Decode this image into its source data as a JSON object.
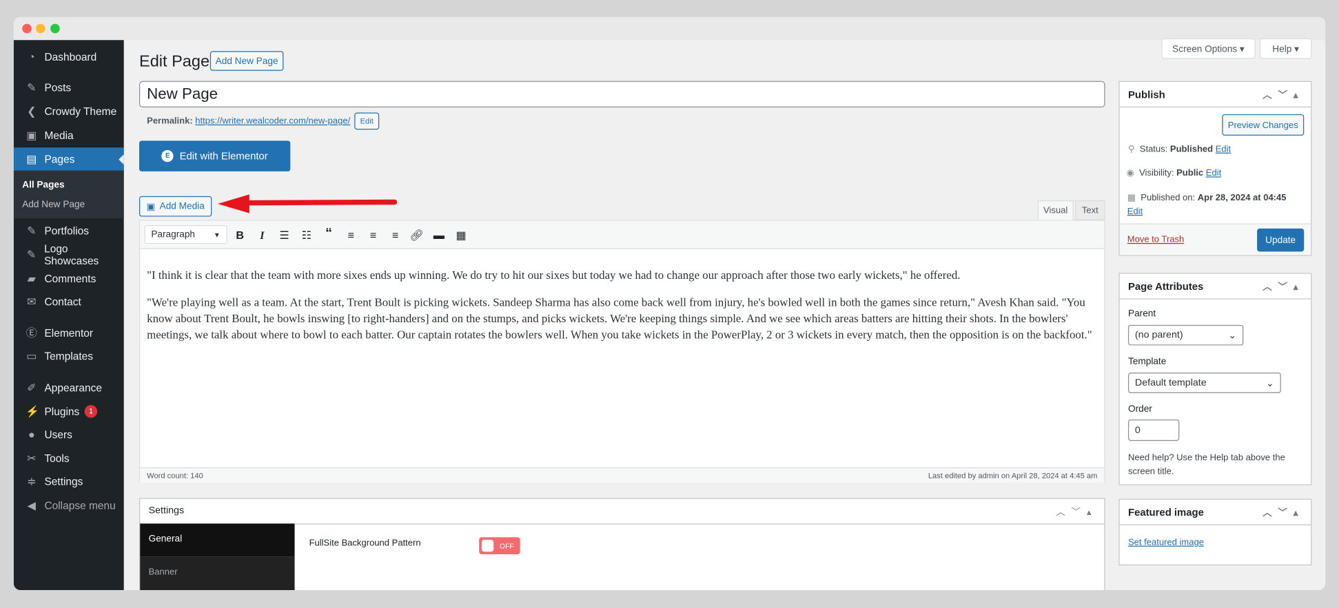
{
  "sidebar": {
    "items": [
      {
        "label": "Dashboard",
        "icon": "dashboard-icon",
        "glyph": "◔"
      },
      {
        "label": "Posts",
        "icon": "pin-icon",
        "glyph": "✎"
      },
      {
        "label": "Crowdy Theme",
        "icon": "crowdy-icon",
        "glyph": "❮"
      },
      {
        "label": "Media",
        "icon": "media-icon",
        "glyph": "▣"
      },
      {
        "label": "Pages",
        "icon": "pages-icon",
        "glyph": "▤"
      },
      {
        "label": "Portfolios",
        "icon": "pin-icon",
        "glyph": "✎"
      },
      {
        "label": "Logo Showcases",
        "icon": "pin-icon",
        "glyph": "✎"
      },
      {
        "label": "Comments",
        "icon": "comment-icon",
        "glyph": "▰"
      },
      {
        "label": "Contact",
        "icon": "mail-icon",
        "glyph": "✉"
      },
      {
        "label": "Elementor",
        "icon": "elementor-icon",
        "glyph": "Ⓔ"
      },
      {
        "label": "Templates",
        "icon": "folder-icon",
        "glyph": "▭"
      },
      {
        "label": "Appearance",
        "icon": "brush-icon",
        "glyph": "✐"
      },
      {
        "label": "Plugins",
        "icon": "plugin-icon",
        "glyph": "⚡",
        "badge": "1"
      },
      {
        "label": "Users",
        "icon": "user-icon",
        "glyph": "●"
      },
      {
        "label": "Tools",
        "icon": "wrench-icon",
        "glyph": "✂"
      },
      {
        "label": "Settings",
        "icon": "settings-icon",
        "glyph": "≑"
      },
      {
        "label": "Collapse menu",
        "icon": "collapse-icon",
        "glyph": "◀"
      }
    ],
    "submenu": [
      "All Pages",
      "Add New Page"
    ]
  },
  "header": {
    "title": "Edit Page",
    "add_new": "Add New Page",
    "screen_options": "Screen Options ▾",
    "help": "Help ▾"
  },
  "editor": {
    "title_value": "New Page",
    "permalink_label": "Permalink:",
    "permalink_url": "https://writer.wealcoder.com/new-page/",
    "permalink_edit": "Edit",
    "elementor_btn": "Edit with Elementor",
    "add_media": "Add Media",
    "tab_visual": "Visual",
    "tab_text": "Text",
    "format_select": "Paragraph",
    "paragraphs": [
      "\"I think it is clear that the team with more sixes ends up winning. We do try to hit our sixes but today we had to change our approach after those two early wickets,\" he offered.",
      "\"We're playing well as a team. At the start, Trent Boult is picking wickets. Sandeep Sharma has also come back well from injury, he's bowled well in both the games since return,\" Avesh Khan said. \"You know about Trent Boult, he bowls inswing [to right-handers] and on the stumps, and picks wickets. We're keeping things simple. And we see which areas batters are hitting their shots. In the bowlers' meetings, we talk about where to bowl to each batter. Our captain rotates the bowlers well. When you take wickets in the PowerPlay, 2 or 3 wickets in every match, then the opposition is on the backfoot.\""
    ],
    "word_count": "Word count: 140",
    "last_edited": "Last edited by admin on April 28, 2024 at 4:45 am"
  },
  "settings": {
    "title": "Settings",
    "tabs": [
      "General",
      "Banner"
    ],
    "field_label": "FullSite Background Pattern",
    "toggle": "OFF"
  },
  "publish": {
    "title": "Publish",
    "preview": "Preview Changes",
    "status_label": "Status:",
    "status": "Published",
    "visibility_label": "Visibility:",
    "visibility": "Public",
    "published_label": "Published on:",
    "published": "Apr 28, 2024 at 04:45",
    "edit": "Edit",
    "trash": "Move to Trash",
    "update": "Update"
  },
  "attributes": {
    "title": "Page Attributes",
    "parent_label": "Parent",
    "parent_value": "(no parent)",
    "template_label": "Template",
    "template_value": "Default template",
    "order_label": "Order",
    "order_value": "0",
    "help": "Need help? Use the Help tab above the screen title."
  },
  "featured": {
    "title": "Featured image",
    "link": "Set featured image"
  },
  "colors": {
    "accent": "#2271b1",
    "sidebar": "#1d2327",
    "arrow": "#e8141b",
    "toggle_off": "#f16b6f"
  }
}
